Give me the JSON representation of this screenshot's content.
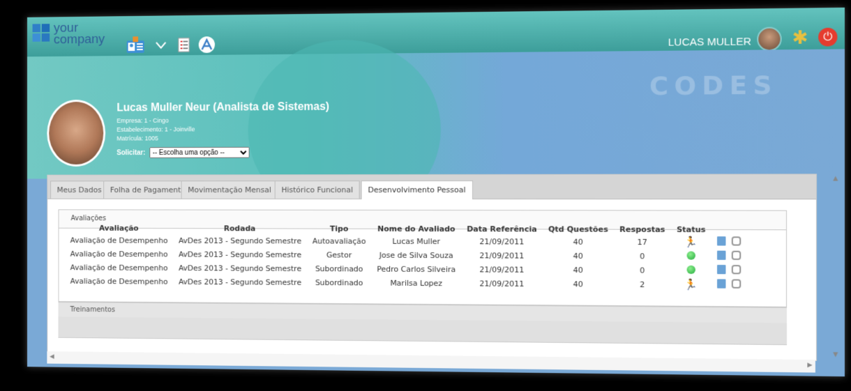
{
  "header": {
    "logo_line1": "your",
    "logo_line2": "company",
    "username": "LUCAS MULLER",
    "icons": [
      "contact-card-icon",
      "chevron-down-icon",
      "document-list-icon",
      "pdf-icon",
      "user-avatar-icon",
      "settings-icon",
      "power-icon"
    ]
  },
  "hero": {
    "watermark": "CODES",
    "name": "Lucas Muller Neur (Analista de Sistemas)",
    "empresa": "Empresa: 1 - Cingo",
    "estabelecimento": "Estabelecimento: 1 - Joinville",
    "matricula": "Matrícula: 1005",
    "solicitar_label": "Solicitar:",
    "solicitar_value": "-- Escolha uma opção --"
  },
  "tabs": [
    {
      "label": "Meus Dados"
    },
    {
      "label": "Folha de Pagamento"
    },
    {
      "label": "Movimentação Mensal"
    },
    {
      "label": "Histórico Funcional"
    },
    {
      "label": "Desenvolvimento Pessoal",
      "active": true
    }
  ],
  "avaliacoes": {
    "title": "Avaliações",
    "columns": [
      "Avaliação",
      "Rodada",
      "Tipo",
      "Nome do Avaliado",
      "Data Referência",
      "Qtd Questões",
      "Respostas",
      "Status"
    ],
    "rows": [
      {
        "avaliacao": "Avaliação de Desempenho",
        "rodada": "AvDes 2013 - Segundo Semestre",
        "tipo": "Autoavaliação",
        "nome": "Lucas Muller",
        "data": "21/09/2011",
        "qtd": "40",
        "respostas": "17",
        "status": "running-icon"
      },
      {
        "avaliacao": "Avaliação de Desempenho",
        "rodada": "AvDes 2013 - Segundo Semestre",
        "tipo": "Gestor",
        "nome": "Jose de Silva Souza",
        "data": "21/09/2011",
        "qtd": "40",
        "respostas": "0",
        "status": "green-dot-icon"
      },
      {
        "avaliacao": "Avaliação de Desempenho",
        "rodada": "AvDes 2013 - Segundo Semestre",
        "tipo": "Subordinado",
        "nome": "Pedro Carlos Silveira",
        "data": "21/09/2011",
        "qtd": "40",
        "respostas": "0",
        "status": "green-dot-icon"
      },
      {
        "avaliacao": "Avaliação de Desempenho",
        "rodada": "AvDes 2013 - Segundo Semestre",
        "tipo": "Subordinado",
        "nome": "Marilsa Lopez",
        "data": "21/09/2011",
        "qtd": "40",
        "respostas": "2",
        "status": "running-icon"
      }
    ]
  },
  "treinamentos": {
    "title": "Treinamentos"
  },
  "colors": {
    "topbar": "#4fb3ae",
    "accent": "#2f7fc8",
    "status_green": "#2fbf4a"
  }
}
